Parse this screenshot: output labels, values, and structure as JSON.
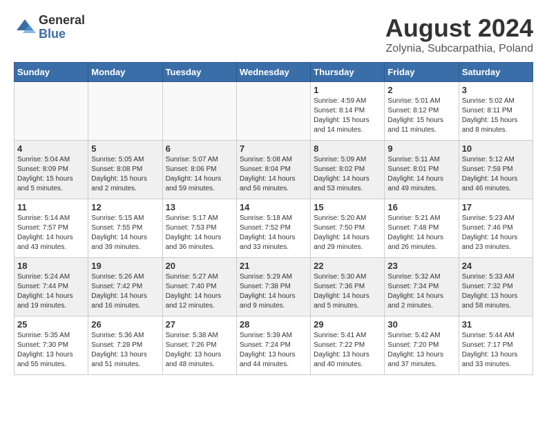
{
  "header": {
    "logo_general": "General",
    "logo_blue": "Blue",
    "main_title": "August 2024",
    "subtitle": "Zolynia, Subcarpathia, Poland"
  },
  "days_of_week": [
    "Sunday",
    "Monday",
    "Tuesday",
    "Wednesday",
    "Thursday",
    "Friday",
    "Saturday"
  ],
  "weeks": [
    [
      {
        "day": "",
        "info": ""
      },
      {
        "day": "",
        "info": ""
      },
      {
        "day": "",
        "info": ""
      },
      {
        "day": "",
        "info": ""
      },
      {
        "day": "1",
        "info": "Sunrise: 4:59 AM\nSunset: 8:14 PM\nDaylight: 15 hours\nand 14 minutes."
      },
      {
        "day": "2",
        "info": "Sunrise: 5:01 AM\nSunset: 8:12 PM\nDaylight: 15 hours\nand 11 minutes."
      },
      {
        "day": "3",
        "info": "Sunrise: 5:02 AM\nSunset: 8:11 PM\nDaylight: 15 hours\nand 8 minutes."
      }
    ],
    [
      {
        "day": "4",
        "info": "Sunrise: 5:04 AM\nSunset: 8:09 PM\nDaylight: 15 hours\nand 5 minutes."
      },
      {
        "day": "5",
        "info": "Sunrise: 5:05 AM\nSunset: 8:08 PM\nDaylight: 15 hours\nand 2 minutes."
      },
      {
        "day": "6",
        "info": "Sunrise: 5:07 AM\nSunset: 8:06 PM\nDaylight: 14 hours\nand 59 minutes."
      },
      {
        "day": "7",
        "info": "Sunrise: 5:08 AM\nSunset: 8:04 PM\nDaylight: 14 hours\nand 56 minutes."
      },
      {
        "day": "8",
        "info": "Sunrise: 5:09 AM\nSunset: 8:02 PM\nDaylight: 14 hours\nand 53 minutes."
      },
      {
        "day": "9",
        "info": "Sunrise: 5:11 AM\nSunset: 8:01 PM\nDaylight: 14 hours\nand 49 minutes."
      },
      {
        "day": "10",
        "info": "Sunrise: 5:12 AM\nSunset: 7:59 PM\nDaylight: 14 hours\nand 46 minutes."
      }
    ],
    [
      {
        "day": "11",
        "info": "Sunrise: 5:14 AM\nSunset: 7:57 PM\nDaylight: 14 hours\nand 43 minutes."
      },
      {
        "day": "12",
        "info": "Sunrise: 5:15 AM\nSunset: 7:55 PM\nDaylight: 14 hours\nand 39 minutes."
      },
      {
        "day": "13",
        "info": "Sunrise: 5:17 AM\nSunset: 7:53 PM\nDaylight: 14 hours\nand 36 minutes."
      },
      {
        "day": "14",
        "info": "Sunrise: 5:18 AM\nSunset: 7:52 PM\nDaylight: 14 hours\nand 33 minutes."
      },
      {
        "day": "15",
        "info": "Sunrise: 5:20 AM\nSunset: 7:50 PM\nDaylight: 14 hours\nand 29 minutes."
      },
      {
        "day": "16",
        "info": "Sunrise: 5:21 AM\nSunset: 7:48 PM\nDaylight: 14 hours\nand 26 minutes."
      },
      {
        "day": "17",
        "info": "Sunrise: 5:23 AM\nSunset: 7:46 PM\nDaylight: 14 hours\nand 23 minutes."
      }
    ],
    [
      {
        "day": "18",
        "info": "Sunrise: 5:24 AM\nSunset: 7:44 PM\nDaylight: 14 hours\nand 19 minutes."
      },
      {
        "day": "19",
        "info": "Sunrise: 5:26 AM\nSunset: 7:42 PM\nDaylight: 14 hours\nand 16 minutes."
      },
      {
        "day": "20",
        "info": "Sunrise: 5:27 AM\nSunset: 7:40 PM\nDaylight: 14 hours\nand 12 minutes."
      },
      {
        "day": "21",
        "info": "Sunrise: 5:29 AM\nSunset: 7:38 PM\nDaylight: 14 hours\nand 9 minutes."
      },
      {
        "day": "22",
        "info": "Sunrise: 5:30 AM\nSunset: 7:36 PM\nDaylight: 14 hours\nand 5 minutes."
      },
      {
        "day": "23",
        "info": "Sunrise: 5:32 AM\nSunset: 7:34 PM\nDaylight: 14 hours\nand 2 minutes."
      },
      {
        "day": "24",
        "info": "Sunrise: 5:33 AM\nSunset: 7:32 PM\nDaylight: 13 hours\nand 58 minutes."
      }
    ],
    [
      {
        "day": "25",
        "info": "Sunrise: 5:35 AM\nSunset: 7:30 PM\nDaylight: 13 hours\nand 55 minutes."
      },
      {
        "day": "26",
        "info": "Sunrise: 5:36 AM\nSunset: 7:28 PM\nDaylight: 13 hours\nand 51 minutes."
      },
      {
        "day": "27",
        "info": "Sunrise: 5:38 AM\nSunset: 7:26 PM\nDaylight: 13 hours\nand 48 minutes."
      },
      {
        "day": "28",
        "info": "Sunrise: 5:39 AM\nSunset: 7:24 PM\nDaylight: 13 hours\nand 44 minutes."
      },
      {
        "day": "29",
        "info": "Sunrise: 5:41 AM\nSunset: 7:22 PM\nDaylight: 13 hours\nand 40 minutes."
      },
      {
        "day": "30",
        "info": "Sunrise: 5:42 AM\nSunset: 7:20 PM\nDaylight: 13 hours\nand 37 minutes."
      },
      {
        "day": "31",
        "info": "Sunrise: 5:44 AM\nSunset: 7:17 PM\nDaylight: 13 hours\nand 33 minutes."
      }
    ]
  ]
}
